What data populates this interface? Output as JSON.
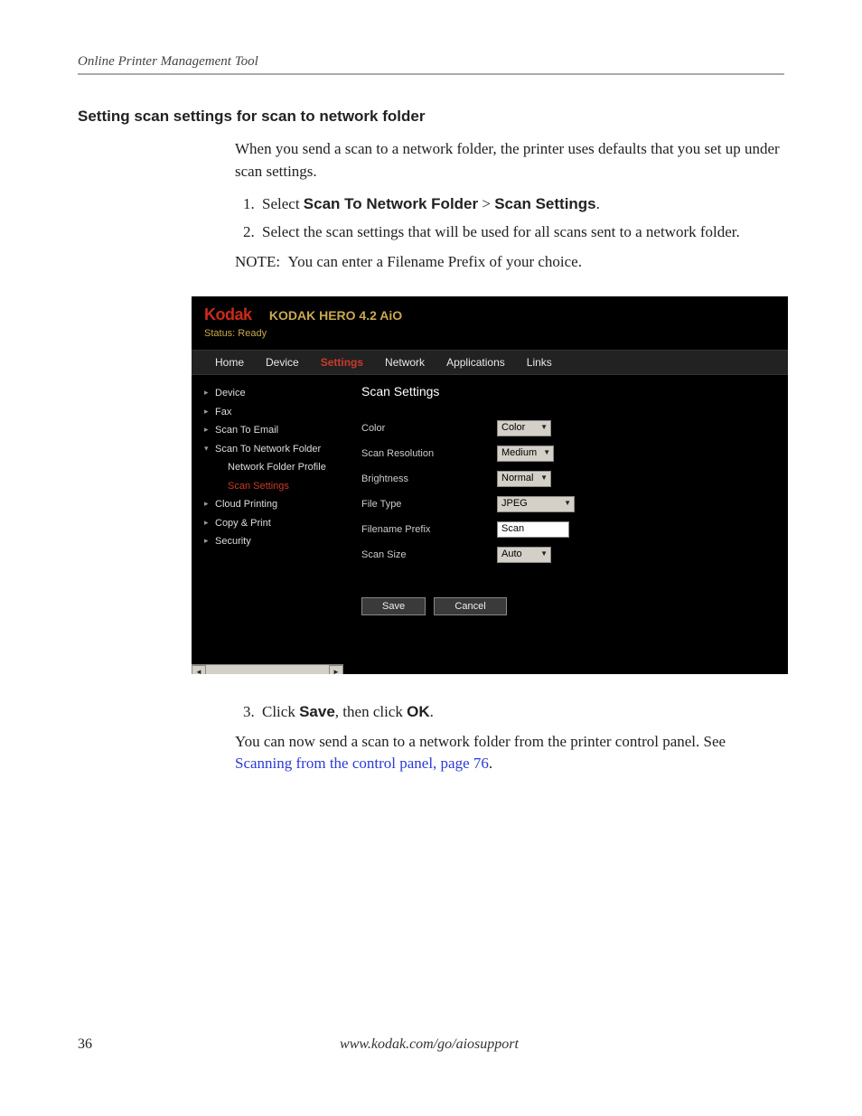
{
  "header": {
    "running": "Online Printer Management Tool"
  },
  "section": {
    "heading": "Setting scan settings for scan to network folder",
    "intro": "When you send a scan to a network folder, the printer uses defaults that you set up under scan settings.",
    "step1_pre": "Select ",
    "step1_b1": "Scan To Network Folder",
    "step1_mid": " > ",
    "step1_b2": "Scan Settings",
    "step1_end": ".",
    "step2": "Select the scan settings that will be used for all scans sent to a network folder.",
    "note_label": "NOTE:",
    "note_text": "You can enter a Filename Prefix of your choice.",
    "step3_pre": "Click ",
    "step3_b1": "Save",
    "step3_mid": ", then click ",
    "step3_b2": "OK",
    "step3_end": ".",
    "after": "You can now send a scan to a network folder from the printer control panel. See ",
    "link": "Scanning from the control panel, page 76",
    "after_end": "."
  },
  "ui": {
    "logo": "Kodak",
    "product": "KODAK HERO 4.2 AiO",
    "status": "Status: Ready",
    "tabs": [
      "Home",
      "Device",
      "Settings",
      "Network",
      "Applications",
      "Links"
    ],
    "active_tab": 2,
    "sidebar": [
      {
        "label": "Device",
        "caret": "▸",
        "sub": false
      },
      {
        "label": "Fax",
        "caret": "▸",
        "sub": false
      },
      {
        "label": "Scan To Email",
        "caret": "▸",
        "sub": false
      },
      {
        "label": "Scan To Network Folder",
        "caret": "▾",
        "sub": false
      },
      {
        "label": "Network Folder Profile",
        "caret": "",
        "sub": true
      },
      {
        "label": "Scan Settings",
        "caret": "",
        "sub": true,
        "selected": true
      },
      {
        "label": "Cloud Printing",
        "caret": "▸",
        "sub": false
      },
      {
        "label": "Copy & Print",
        "caret": "▸",
        "sub": false
      },
      {
        "label": "Security",
        "caret": "▸",
        "sub": false
      }
    ],
    "panel": {
      "title": "Scan Settings",
      "rows": {
        "color": {
          "label": "Color",
          "value": "Color",
          "type": "select"
        },
        "resolution": {
          "label": "Scan Resolution",
          "value": "Medium",
          "type": "select"
        },
        "brightness": {
          "label": "Brightness",
          "value": "Normal",
          "type": "select"
        },
        "filetype": {
          "label": "File Type",
          "value": "JPEG",
          "type": "select",
          "wide": true
        },
        "prefix": {
          "label": "Filename Prefix",
          "value": "Scan",
          "type": "input"
        },
        "scansize": {
          "label": "Scan Size",
          "value": "Auto",
          "type": "select"
        }
      },
      "save": "Save",
      "cancel": "Cancel"
    }
  },
  "footer": {
    "page": "36",
    "url": "www.kodak.com/go/aiosupport"
  }
}
